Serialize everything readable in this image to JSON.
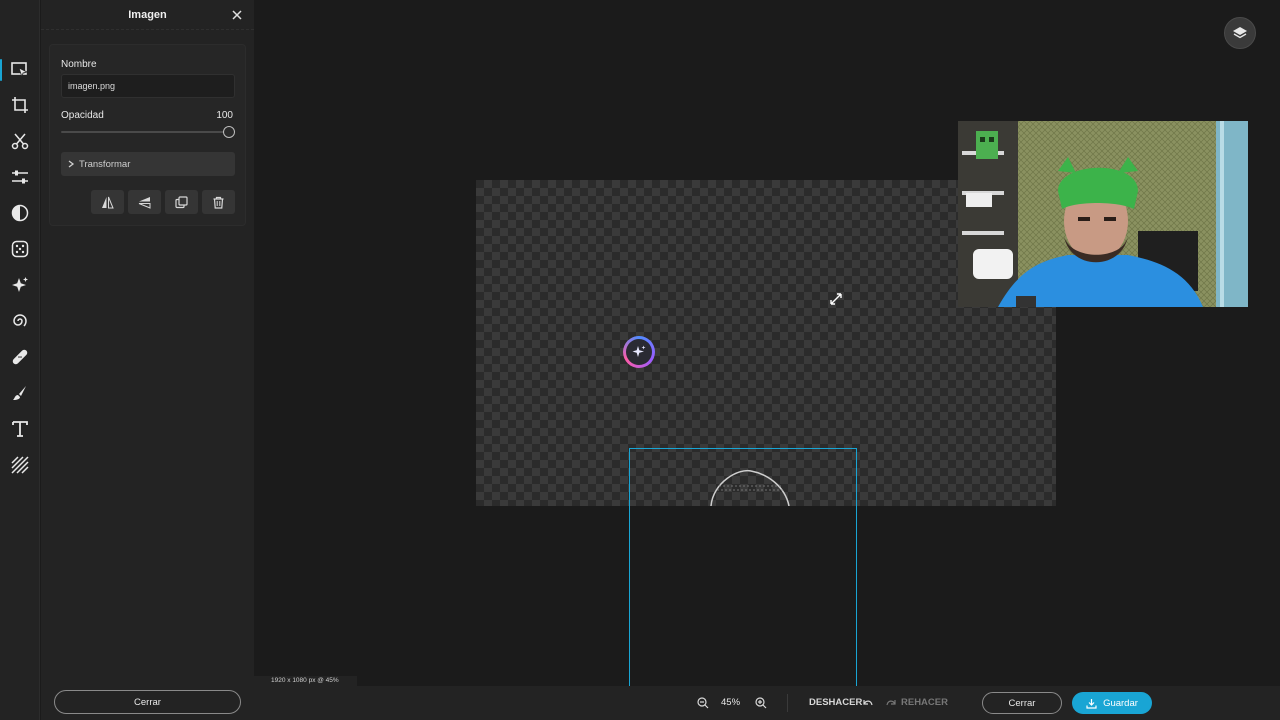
{
  "panel": {
    "title": "Imagen",
    "name_label": "Nombre",
    "name_value": "imagen.png",
    "opacity_label": "Opacidad",
    "opacity_value": "100",
    "opacity_level": 1.0,
    "transform_label": "Transformar",
    "close_label": "Cerrar",
    "actions": [
      "flip-horizontal-icon",
      "flip-vertical-icon",
      "duplicate-icon",
      "trash-icon"
    ]
  },
  "rail": {
    "tools": [
      "select-icon",
      "crop-icon",
      "cut-icon",
      "adjust-icon",
      "filter-icon",
      "effects-icon",
      "ai-sparkle-icon",
      "liquify-icon",
      "heal-icon",
      "brush-icon",
      "text-icon",
      "texture-icon"
    ],
    "active": "select-icon"
  },
  "canvas": {
    "status": "1920 x 1080 px @ 45%"
  },
  "bottom_bar": {
    "zoom": "45%",
    "undo_label": "DESHACER",
    "redo_label": "REHACER",
    "close_label": "Cerrar",
    "save_label": "Guardar"
  },
  "colors": {
    "accent": "#19a5d4",
    "panel_bg": "#232323",
    "workspace_bg": "#1b1b1b"
  }
}
